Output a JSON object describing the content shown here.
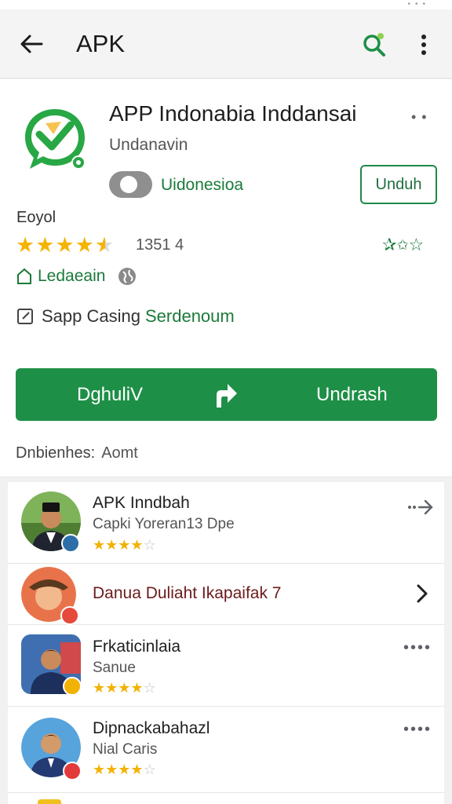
{
  "appbar": {
    "title": "APK",
    "back_icon": "arrow-left-icon",
    "search_icon": "search-icon",
    "more_icon": "more-vert-icon"
  },
  "detail": {
    "app_name": "APP Indonabia Inddansai",
    "developer": "Undanavin",
    "language_label": "Uidonesioa",
    "unduh_button": "Unduh",
    "eyebrow": "Eoyol",
    "rating_value": 4.5,
    "rating_count": "1351 4",
    "badge_label": "Ledaeain",
    "note_prefix": "Sapp Casing",
    "note_link": "Serdenoum",
    "install_left": "DghuliV",
    "install_right": "Undrash",
    "info_label": "Dnbienhes:",
    "info_value": "Aomt"
  },
  "list": {
    "items": [
      {
        "name": "APK Inndbah",
        "sub": "Capki Yoreran13 Dpe",
        "rating": 4,
        "action": "share-icon"
      },
      {
        "name": "Danua Duliaht Ikapaifak 7",
        "action": "chevron-right-icon"
      },
      {
        "name": "Frkaticinlaia",
        "sub": "Sanue",
        "rating": 4,
        "action": "more-horiz-icon"
      },
      {
        "name": "Dipnackabahazl",
        "sub": "Nial Caris",
        "rating": 4,
        "action": "more-horiz-icon"
      }
    ]
  },
  "colors": {
    "accent_green": "#1e8f47",
    "star_yellow": "#f5b400",
    "link_green": "#1b7a3a"
  }
}
